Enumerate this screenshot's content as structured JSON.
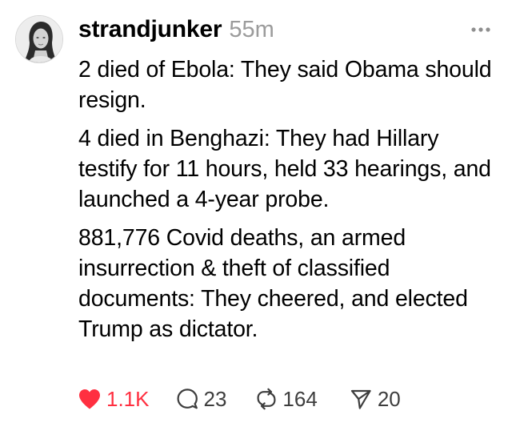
{
  "post": {
    "author": "strandjunker",
    "timestamp": "55m",
    "paragraphs": [
      "2 died of Ebola: They said Obama should resign.",
      "4 died in Benghazi: They had Hillary testify for 11 hours, held 33 hearings, and launched a 4-year probe.",
      "881,776 Covid deaths, an armed insurrection & theft of classified documents: They cheered, and elected Trump as dictator."
    ],
    "actions": {
      "likes": "1.1K",
      "replies": "23",
      "reposts": "164",
      "shares": "20",
      "liked": true
    }
  },
  "icons": {
    "avatar": "avatar",
    "more": "more-icon",
    "like": "heart-icon",
    "reply": "speech-bubble-icon",
    "repost": "repost-icon",
    "share": "send-icon"
  },
  "colors": {
    "like_active": "#ff2f40",
    "muted_text": "#9b9b9b",
    "action_text": "#3d3d3d"
  }
}
